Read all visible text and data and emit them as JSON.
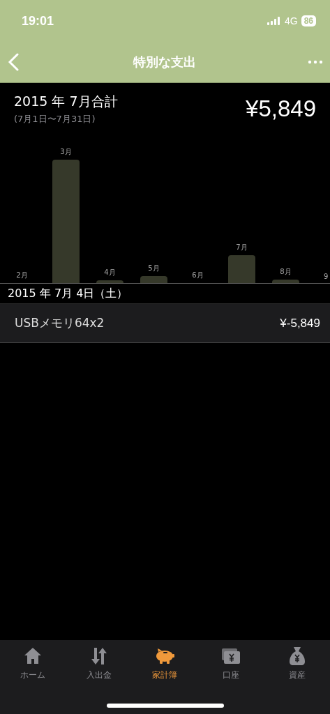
{
  "status_bar": {
    "time": "19:01",
    "network": "4G",
    "battery": "86"
  },
  "nav": {
    "title": "特別な支出"
  },
  "summary": {
    "title": "2015 年 7月合計",
    "range": "(7月1日〜7月31日)",
    "total": "¥5,849"
  },
  "bars": [
    {
      "label": "2月"
    },
    {
      "label": "3月"
    },
    {
      "label": "4月"
    },
    {
      "label": "5月"
    },
    {
      "label": "6月"
    },
    {
      "label": "7月"
    },
    {
      "label": "8月"
    },
    {
      "label": "9"
    }
  ],
  "day_header": "2015 年 7月 4日（土）",
  "entries": [
    {
      "name": "USBメモリ64x2",
      "amount": "¥-5,849"
    }
  ],
  "tabs": [
    {
      "label": "ホーム",
      "selected": false
    },
    {
      "label": "入出金",
      "selected": false
    },
    {
      "label": "家計簿",
      "selected": true
    },
    {
      "label": "口座",
      "selected": false
    },
    {
      "label": "資産",
      "selected": false
    }
  ]
}
